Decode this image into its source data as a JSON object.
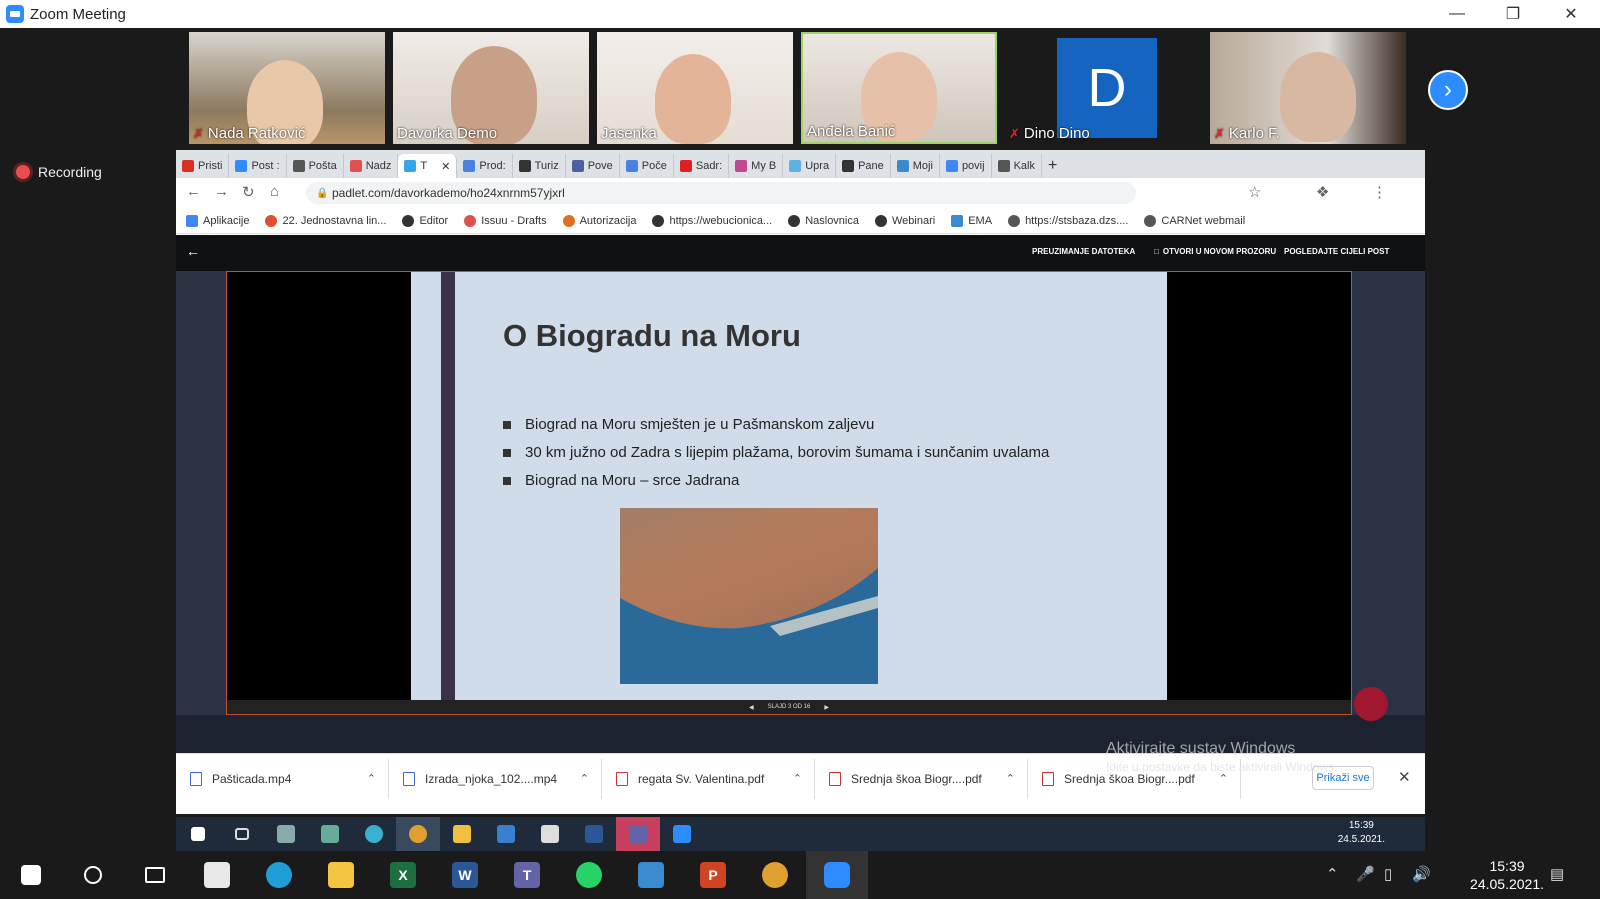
{
  "window": {
    "title": "Zoom Meeting"
  },
  "participants": [
    {
      "name": "Nada Ratković",
      "muted": true
    },
    {
      "name": "Davorka Demo",
      "muted": false
    },
    {
      "name": "Jasenka",
      "muted": false
    },
    {
      "name": "Anđela Banić",
      "muted": false
    },
    {
      "name": "Dino Dino",
      "muted": true,
      "initial": "D"
    },
    {
      "name": "Karlo F.",
      "muted": true
    }
  ],
  "recording": {
    "label": "Recording"
  },
  "browser": {
    "tabs": [
      "Pristi",
      "Post :",
      "Pošta",
      "Nadz",
      "T",
      "Prod:",
      "Turiz",
      "Pove",
      "Poče",
      "Sadr:",
      "My B",
      "Upra",
      "Pane",
      "Moji",
      "povij",
      "Kalk"
    ],
    "url": "padlet.com/davorkademo/ho24xnrnm57yjxrl",
    "bookmarks": [
      "Aplikacije",
      "22. Jednostavna lin...",
      "Editor",
      "Issuu - Drafts",
      "Autorizacija",
      "https://webucionica...",
      "Naslovnica",
      "Webinari",
      "EMA",
      "https://stsbaza.dzs....",
      "CARNet webmail"
    ]
  },
  "padlet": {
    "tools": [
      "PREUZIMANJE DATOTEKA",
      "OTVORI U NOVOM PROZORU",
      "POGLEDAJTE CIJELI POST"
    ],
    "slide_counter": "SLAJD 3 OD 16"
  },
  "slide": {
    "title": "O Biogradu na Moru",
    "bullets": [
      "Biograd na Moru smješten je u Pašmanskom zaljevu",
      "30 km južno od Zadra s lijepim plažama, borovim šumama i sunčanim uvalama",
      "Biograd na Moru – srce Jadrana"
    ]
  },
  "windows_watermark": {
    "line1": "Aktivirajte sustav Windows",
    "line2": "Idite u postavke da biste aktivirali Windows."
  },
  "downloads": {
    "items": [
      "Pašticada.mp4",
      "Izrada_njoka_102....mp4",
      "regata Sv. Valentina.pdf",
      "Srednja škoa Biogr....pdf",
      "Srednja škoa Biogr....pdf"
    ],
    "show_all": "Prikaži sve"
  },
  "inner_clock": {
    "time": "15:39",
    "date": "24.5.2021."
  },
  "clock": {
    "time": "15:39",
    "date": "24.05.2021."
  },
  "colors": {
    "zoom_blue": "#2d8cff",
    "dark_bg": "#1a1a1a",
    "slide_bg": "#d0dcea"
  }
}
